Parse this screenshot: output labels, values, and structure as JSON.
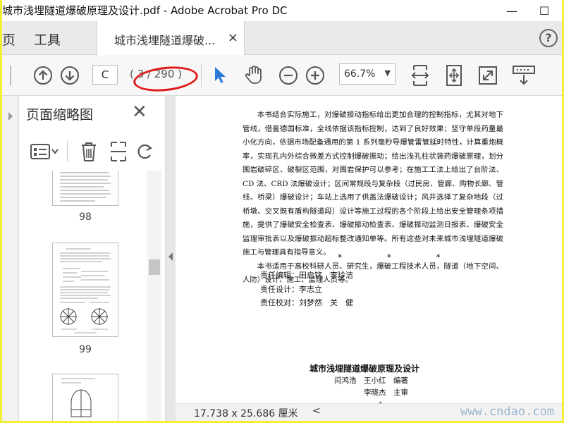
{
  "window": {
    "title": "城市浅埋隧道爆破原理及设计.pdf - Adobe Acrobat Pro DC",
    "minimize": "—",
    "maximize": "☐"
  },
  "tabs": {
    "home": "页",
    "tools": "工具",
    "document": "城市浅埋隧道爆破...",
    "close": "×",
    "help": "?"
  },
  "toolbar": {
    "current_page": "C",
    "page_count": "( 3 / 290 )",
    "zoom": "66.7%"
  },
  "thumbnail_panel": {
    "title": "页面缩略图",
    "close": "✕",
    "thumbs": [
      {
        "page": "98"
      },
      {
        "page": "99"
      }
    ]
  },
  "document": {
    "paragraphs": [
      "本书结合实际施工，对爆破振动指标给出更加合理的控制指标，尤其对地下管线，借鉴德国标准，全线依据该指标控制，达到了良好效果；坚守单段药量最小化方向，依据市场配备通用的第 1 系列毫秒导爆管雷管延时特性，计算重炮概率，实现孔内外综合微差方式控制爆破振动；给出浅孔柱状装药爆破原理，划分围岩破碎区、破裂区范围，对围岩保护可以参考；在施工工法上给出了台阶法、CD 法、CRD 法爆破设计；区间常规段与复杂段（过民房、管廊、购物长廊、管线、桥梁）爆破设计；车站上选用了供盖法爆破设计；风井选择了复杂地段（过桥墩、交叉既有盾构隧道段）设计等施工过程的各个阶段上给出安全管理条项措施，提供了爆破安全检查表、爆破振动检查表、爆破振动监测日报表、爆破安全监理审批表以及爆破振动超标整改通知单等。所有这些对未来城市浅埋隧道爆破施工与管理具有指导意义。",
      "本书适用于高校科研人员、研究生，爆破工程技术人员，隧道（地下空间、人防）设计、施工、监理人员等。"
    ],
    "stars": "* * *",
    "credits": [
      "责任编辑：田启铭　李玲洁",
      "责任设计：李志立",
      "责任校对：刘梦然　关　健"
    ],
    "cip_title": "城市浅埋隧道爆破原理及设计",
    "cip_authors": "闫鸿浩　王小红　编著\n　　　　李晓杰　主审\n　　　　　　*"
  },
  "status": {
    "page_size": "17.738 x 25.686 厘米",
    "watermark": "www.cndao.com"
  },
  "colors": {
    "highlight_ellipse": "#e01b1b",
    "select_tool": "#2b7bd8",
    "screenshot_border": "#f2ef3a"
  }
}
